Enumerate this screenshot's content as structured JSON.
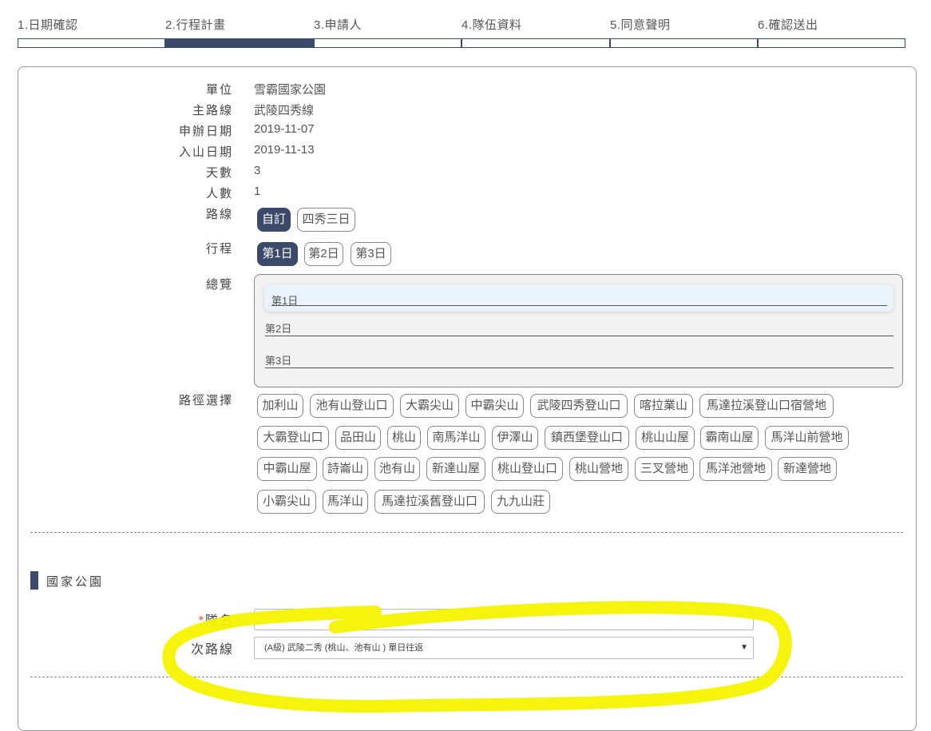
{
  "steps": [
    {
      "label": "1.日期確認"
    },
    {
      "label": "2.行程計畫"
    },
    {
      "label": "3.申請人"
    },
    {
      "label": "4.隊伍資料"
    },
    {
      "label": "5.同意聲明"
    },
    {
      "label": "6.確認送出"
    }
  ],
  "info": {
    "unit_label": "單位",
    "unit_value": "雪霸國家公園",
    "route_label": "主路線",
    "route_value": "武陵四秀線",
    "apply_date_label": "申辦日期",
    "apply_date_value": "2019-11-07",
    "enter_date_label": "入山日期",
    "enter_date_value": "2019-11-13",
    "days_label": "天數",
    "days_value": "3",
    "people_label": "人數",
    "people_value": "1",
    "path_label": "路線",
    "schedule_label": "行程",
    "overview_label": "總覽",
    "path_select_label": "路徑選擇"
  },
  "path_options": [
    "自訂",
    "四秀三日"
  ],
  "day_tabs": [
    "第1日",
    "第2日",
    "第3日"
  ],
  "overview_days": [
    "第1日",
    "第2日",
    "第3日"
  ],
  "locations": [
    "加利山",
    "池有山登山口",
    "大霸尖山",
    "中霸尖山",
    "武陵四秀登山口",
    "喀拉業山",
    "馬達拉溪登山口宿營地",
    "大霸登山口",
    "品田山",
    "桃山",
    "南馬洋山",
    "伊澤山",
    "鎮西堡登山口",
    "桃山山屋",
    "霸南山屋",
    "馬洋山前營地",
    "中霸山屋",
    "詩崙山",
    "池有山",
    "新達山屋",
    "桃山登山口",
    "桃山營地",
    "三叉營地",
    "馬洋池營地",
    "新達營地",
    "小霸尖山",
    "馬洋山",
    "馬達拉溪舊登山口",
    "九九山莊"
  ],
  "section": {
    "title": "國家公園"
  },
  "form": {
    "required_mark": "*",
    "team_name_label": "隊名",
    "team_name_value": "",
    "sub_route_label": "次路線",
    "sub_route_value": "(A級) 武陵二秀 (桃山、池有山 ) 單日往返",
    "arrow": "▼"
  },
  "colors": {
    "accent": "#3b4a6b",
    "highlight": "#f5f200",
    "required": "#e05050"
  }
}
